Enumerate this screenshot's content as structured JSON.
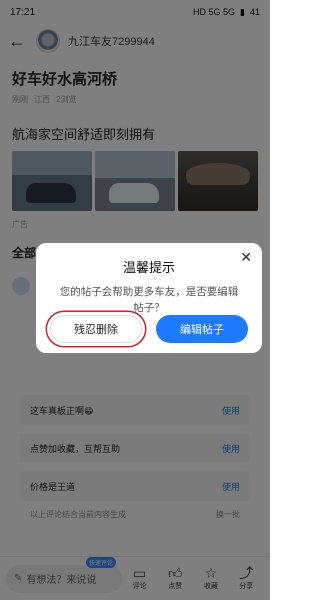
{
  "status_bar": {
    "time": "17:21",
    "icons": "HD 5G 5G",
    "battery": "41"
  },
  "header": {
    "back_icon": "back-arrow-icon",
    "author": "九江车友7299944"
  },
  "post": {
    "title": "好车好水高河桥",
    "meta_time": "刚刚",
    "meta_location": "江西",
    "meta_views": "2浏览"
  },
  "ad": {
    "headline": "航海家空间舒适即刻拥有",
    "label": "广告"
  },
  "comments": {
    "section_title": "全部",
    "sort": "最新"
  },
  "suggestions": [
    {
      "text": "这车真板正啊😁",
      "action": "使用"
    },
    {
      "text": "点赞加收藏，互帮互助",
      "action": "使用"
    },
    {
      "text": "价格是王道",
      "action": "使用"
    }
  ],
  "suggestion_footer": {
    "left": "以上评论结合当前内容生成",
    "right": "换一批"
  },
  "bottom_bar": {
    "input_placeholder": "有想法？来说说",
    "tag": "快速评论",
    "actions": [
      {
        "icon": "comment-icon",
        "label": "评论"
      },
      {
        "icon": "like-icon",
        "label": "点赞"
      },
      {
        "icon": "star-icon",
        "label": "收藏"
      },
      {
        "icon": "share-icon",
        "label": "分享"
      }
    ]
  },
  "dialog": {
    "title": "温馨提示",
    "message": "您的帖子会帮助更多车友，是否要编辑帖子？",
    "delete_label": "残忍删除",
    "edit_label": "编辑帖子",
    "accent_color": "#1e7bff",
    "highlight_color": "#d11f2c"
  }
}
